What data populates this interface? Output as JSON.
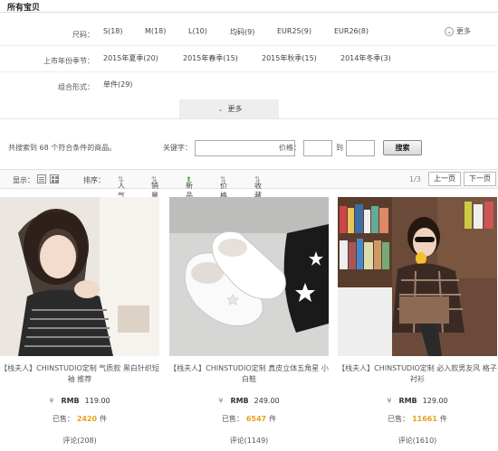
{
  "page_title": "所有宝贝",
  "filters": {
    "size": {
      "label": "尺码：",
      "values": [
        "S(18)",
        "M(18)",
        "L(10)",
        "均码(9)",
        "EUR25(9)",
        "EUR26(8)"
      ]
    },
    "season": {
      "label": "上市年份季节：",
      "values": [
        "2015年夏季(20)",
        "2015年春季(15)",
        "2015年秋季(15)",
        "2014年冬季(3)"
      ]
    },
    "combo": {
      "label": "组合形式：",
      "values": [
        "单件(29)"
      ]
    },
    "more_right": "更多",
    "more_tab": "更多"
  },
  "search": {
    "result_text": "共搜索到 68 个符合条件的商品。",
    "keyword_label": "关键字：",
    "price_label": "价格：",
    "to_label": "到",
    "button": "搜索"
  },
  "sortbar": {
    "display_label": "显示：",
    "sort_label": "排序：",
    "options": [
      "人气",
      "销量",
      "新品",
      "价格",
      "收藏"
    ],
    "page_info": "1/3",
    "prev": "上一页",
    "next": "下一页"
  },
  "products": [
    {
      "name": "【栈夫人】CHINSTUDIO定制 气质款 黑白针织短袖 推荐",
      "currency": "¥",
      "rmb": "RMB",
      "price": "119.00",
      "sold_label": "已售：",
      "sold": "2420",
      "unit": "件",
      "reviews": "评论(208)"
    },
    {
      "name": "【栈夫人】CHINSTUDIO定制 真皮立体五角星 小白鞋",
      "currency": "¥",
      "rmb": "RMB",
      "price": "249.00",
      "sold_label": "已售：",
      "sold": "6547",
      "unit": "件",
      "reviews": "评论(1149)"
    },
    {
      "name": "【栈夫人】CHINSTUDIO定制 必入款男友风 格子衬衫",
      "currency": "¥",
      "rmb": "RMB",
      "price": "129.00",
      "sold_label": "已售：",
      "sold": "11661",
      "unit": "件",
      "reviews": "评论(1610)"
    }
  ],
  "colors": {
    "accent_sold": "#e8a21a",
    "new_arrow": "#6aa84f"
  }
}
